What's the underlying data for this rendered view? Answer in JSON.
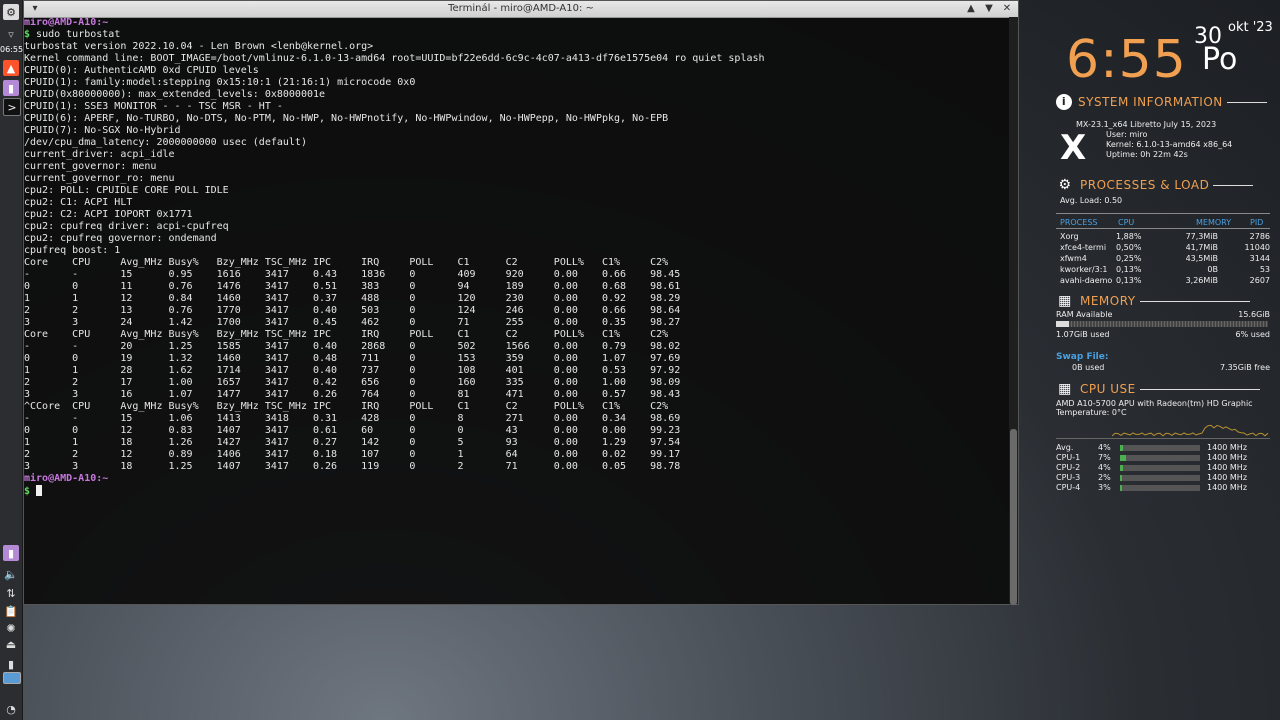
{
  "panel": {
    "clock": "06:55",
    "icons": [
      "app-menu-icon",
      "brave-browser-icon",
      "files-icon",
      "terminal-icon",
      "files-icon-2",
      "volume-icon",
      "network-icon",
      "clipboard-icon",
      "updater-icon",
      "eject-icon",
      "battery-icon",
      "workspace-icon",
      "mx-logo-icon"
    ]
  },
  "window": {
    "title": "Terminál - miro@AMD-A10: ~"
  },
  "terminal": {
    "prompt_user": "miro@AMD-A10",
    "prompt_path": ":~",
    "lines": [
      {
        "t": "prompt",
        "text": "miro@AMD-A10:~"
      },
      {
        "t": "cmd",
        "text": "sudo turbostat"
      },
      {
        "t": "out",
        "text": "turbostat version 2022.10.04 - Len Brown <lenb@kernel.org>"
      },
      {
        "t": "out",
        "text": "Kernel command line: BOOT_IMAGE=/boot/vmlinuz-6.1.0-13-amd64 root=UUID=bf22e6dd-6c9c-4c07-a413-df76e1575e04 ro quiet splash"
      },
      {
        "t": "out",
        "text": "CPUID(0): AuthenticAMD 0xd CPUID levels"
      },
      {
        "t": "out",
        "text": "CPUID(1): family:model:stepping 0x15:10:1 (21:16:1) microcode 0x0"
      },
      {
        "t": "out",
        "text": "CPUID(0x80000000): max_extended_levels: 0x8000001e"
      },
      {
        "t": "out",
        "text": "CPUID(1): SSE3 MONITOR - - - TSC MSR - HT -"
      },
      {
        "t": "out",
        "text": "CPUID(6): APERF, No-TURBO, No-DTS, No-PTM, No-HWP, No-HWPnotify, No-HWPwindow, No-HWPepp, No-HWPpkg, No-EPB"
      },
      {
        "t": "out",
        "text": "CPUID(7): No-SGX No-Hybrid"
      },
      {
        "t": "out",
        "text": "/dev/cpu_dma_latency: 2000000000 usec (default)"
      },
      {
        "t": "out",
        "text": "current_driver: acpi_idle"
      },
      {
        "t": "out",
        "text": "current_governor: menu"
      },
      {
        "t": "out",
        "text": "current_governor_ro: menu"
      },
      {
        "t": "out",
        "text": "cpu2: POLL: CPUIDLE CORE POLL IDLE"
      },
      {
        "t": "out",
        "text": "cpu2: C1: ACPI HLT"
      },
      {
        "t": "out",
        "text": "cpu2: C2: ACPI IOPORT 0x1771"
      },
      {
        "t": "out",
        "text": "cpu2: cpufreq driver: acpi-cpufreq"
      },
      {
        "t": "out",
        "text": "cpu2: cpufreq governor: ondemand"
      },
      {
        "t": "out",
        "text": "cpufreq boost: 1"
      },
      {
        "t": "out",
        "text": "Core    CPU     Avg_MHz Busy%   Bzy_MHz TSC_MHz IPC     IRQ     POLL    C1      C2      POLL%   C1%     C2%"
      },
      {
        "t": "out",
        "text": "-       -       15      0.95    1616    3417    0.43    1836    0       409     920     0.00    0.66    98.45"
      },
      {
        "t": "out",
        "text": "0       0       11      0.76    1476    3417    0.51    383     0       94      189     0.00    0.68    98.61"
      },
      {
        "t": "out",
        "text": "1       1       12      0.84    1460    3417    0.37    488     0       120     230     0.00    0.92    98.29"
      },
      {
        "t": "out",
        "text": "2       2       13      0.76    1770    3417    0.40    503     0       124     246     0.00    0.66    98.64"
      },
      {
        "t": "out",
        "text": "3       3       24      1.42    1700    3417    0.45    462     0       71      255     0.00    0.35    98.27"
      },
      {
        "t": "out",
        "text": "Core    CPU     Avg_MHz Busy%   Bzy_MHz TSC_MHz IPC     IRQ     POLL    C1      C2      POLL%   C1%     C2%"
      },
      {
        "t": "out",
        "text": "-       -       20      1.25    1585    3417    0.40    2868    0       502     1566    0.00    0.79    98.02"
      },
      {
        "t": "out",
        "text": "0       0       19      1.32    1460    3417    0.48    711     0       153     359     0.00    1.07    97.69"
      },
      {
        "t": "out",
        "text": "1       1       28      1.62    1714    3417    0.40    737     0       108     401     0.00    0.53    97.92"
      },
      {
        "t": "out",
        "text": "2       2       17      1.00    1657    3417    0.42    656     0       160     335     0.00    1.00    98.09"
      },
      {
        "t": "out",
        "text": "3       3       16      1.07    1477    3417    0.26    764     0       81      471     0.00    0.57    98.43"
      },
      {
        "t": "out",
        "text": "^CCore  CPU     Avg_MHz Busy%   Bzy_MHz TSC_MHz IPC     IRQ     POLL    C1      C2      POLL%   C1%     C2%"
      },
      {
        "t": "out",
        "text": "-       -       15      1.06    1413    3418    0.31    428     0       8       271     0.00    0.34    98.69"
      },
      {
        "t": "out",
        "text": "0       0       12      0.83    1407    3417    0.61    60      0       0       43      0.00    0.00    99.23"
      },
      {
        "t": "out",
        "text": "1       1       18      1.26    1427    3417    0.27    142     0       5       93      0.00    1.29    97.54"
      },
      {
        "t": "out",
        "text": "2       2       12      0.89    1406    3417    0.18    107     0       1       64      0.00    0.02    99.17"
      },
      {
        "t": "out",
        "text": "3       3       18      1.25    1407    3417    0.26    119     0       2       71      0.00    0.05    98.78"
      },
      {
        "t": "prompt",
        "text": "miro@AMD-A10:~"
      },
      {
        "t": "cursor",
        "text": ""
      }
    ]
  },
  "conky": {
    "time": "6:55",
    "day": "30",
    "month": "okt '23",
    "weekday": "Po",
    "sysinfo": {
      "heading": "SYSTEM INFORMATION",
      "distro": "MX-23.1_x64 Libretto July 15, 2023",
      "user": "User: miro",
      "kernel": "Kernel: 6.1.0-13-amd64 x86_64",
      "uptime": "Uptime: 0h 22m 42s"
    },
    "processes": {
      "heading": "PROCESSES & LOAD",
      "avg_load": "Avg. Load: 0.50",
      "col_process": "PROCESS",
      "col_cpu": "CPU",
      "col_memory": "MEMORY",
      "col_pid": "PID",
      "rows": [
        {
          "name": "Xorg",
          "cpu": "1,88%",
          "mem": "77,3MiB",
          "pid": "2786"
        },
        {
          "name": "xfce4-termi",
          "cpu": "0,50%",
          "mem": "41,7MiB",
          "pid": "11040"
        },
        {
          "name": "xfwm4",
          "cpu": "0,25%",
          "mem": "43,5MiB",
          "pid": "3144"
        },
        {
          "name": "kworker/3:1",
          "cpu": "0,13%",
          "mem": "0B",
          "pid": "53"
        },
        {
          "name": "avahi-daemo",
          "cpu": "0,13%",
          "mem": "3,26MiB",
          "pid": "2607"
        }
      ]
    },
    "memory": {
      "heading": "MEMORY",
      "ram_label": "RAM Available",
      "ram_total": "15.6GiB",
      "ram_used": "1.07GiB used",
      "ram_pct": "6% used",
      "ram_fraction": 0.06,
      "swap_label": "Swap File:",
      "swap_used": "0B used",
      "swap_free": "7.35GiB free"
    },
    "cpu": {
      "heading": "CPU USE",
      "model": "AMD A10-5700 APU with Radeon(tm) HD Graphic",
      "temp": "Temperature:  0°C",
      "rows": [
        {
          "label": "Avg.",
          "pct": "4%",
          "value": 4,
          "freq": "1400 MHz"
        },
        {
          "label": "CPU-1",
          "pct": "7%",
          "value": 7,
          "freq": "1400 MHz"
        },
        {
          "label": "CPU-2",
          "pct": "4%",
          "value": 4,
          "freq": "1400 MHz"
        },
        {
          "label": "CPU-3",
          "pct": "2%",
          "value": 2,
          "freq": "1400 MHz"
        },
        {
          "label": "CPU-4",
          "pct": "3%",
          "value": 3,
          "freq": "1400 MHz"
        }
      ]
    }
  }
}
